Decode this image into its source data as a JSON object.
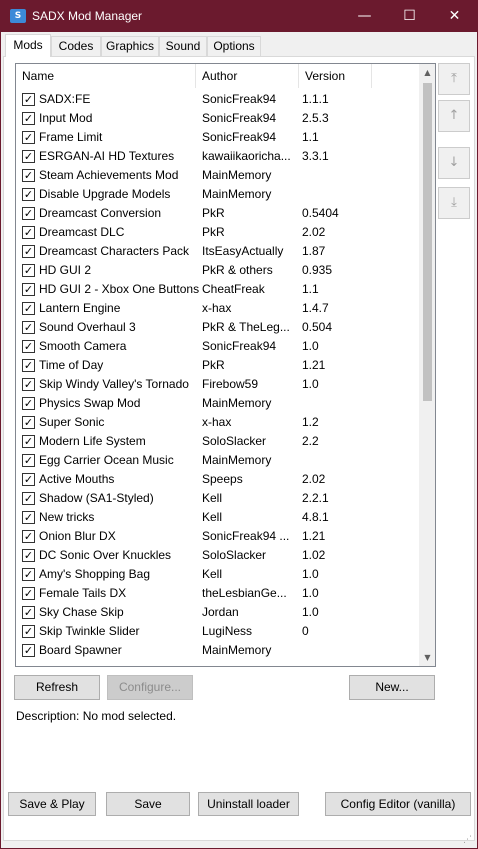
{
  "window": {
    "title": "SADX Mod Manager",
    "icon": "app-logo-icon"
  },
  "titlebar_controls": {
    "minimize": "—",
    "maximize": "☐",
    "close": "✕"
  },
  "tabs": [
    {
      "label": "Mods",
      "active": true
    },
    {
      "label": "Codes",
      "active": false
    },
    {
      "label": "Graphics",
      "active": false
    },
    {
      "label": "Sound",
      "active": false
    },
    {
      "label": "Options",
      "active": false
    }
  ],
  "mod_list": {
    "columns": [
      "Name",
      "Author",
      "Version"
    ],
    "rows": [
      {
        "name": "SADX:FE",
        "author": "SonicFreak94",
        "version": "1.1.1",
        "checked": true
      },
      {
        "name": "Input Mod",
        "author": "SonicFreak94",
        "version": "2.5.3",
        "checked": true
      },
      {
        "name": "Frame Limit",
        "author": "SonicFreak94",
        "version": "1.1",
        "checked": true
      },
      {
        "name": "ESRGAN-AI HD Textures",
        "author": "kawaiikaoricha...",
        "version": "3.3.1",
        "checked": true
      },
      {
        "name": "Steam Achievements Mod",
        "author": "MainMemory",
        "version": "",
        "checked": true
      },
      {
        "name": "Disable Upgrade Models",
        "author": "MainMemory",
        "version": "",
        "checked": true
      },
      {
        "name": "Dreamcast Conversion",
        "author": "PkR",
        "version": "0.5404",
        "checked": true
      },
      {
        "name": "Dreamcast DLC",
        "author": "PkR",
        "version": "2.02",
        "checked": true
      },
      {
        "name": "Dreamcast Characters Pack",
        "author": "ItsEasyActually",
        "version": "1.87",
        "checked": true
      },
      {
        "name": "HD GUI 2",
        "author": "PkR & others",
        "version": "0.935",
        "checked": true
      },
      {
        "name": "HD GUI 2 - Xbox One Buttons",
        "author": "CheatFreak",
        "version": "1.1",
        "checked": true
      },
      {
        "name": "Lantern Engine",
        "author": "x-hax",
        "version": "1.4.7",
        "checked": true
      },
      {
        "name": "Sound Overhaul 3",
        "author": "PkR & TheLeg...",
        "version": "0.504",
        "checked": true
      },
      {
        "name": "Smooth Camera",
        "author": "SonicFreak94",
        "version": "1.0",
        "checked": true
      },
      {
        "name": "Time of Day",
        "author": "PkR",
        "version": "1.21",
        "checked": true
      },
      {
        "name": "Skip Windy Valley's Tornado",
        "author": "Firebow59",
        "version": "1.0",
        "checked": true
      },
      {
        "name": "Physics Swap Mod",
        "author": "MainMemory",
        "version": "",
        "checked": true
      },
      {
        "name": "Super Sonic",
        "author": "x-hax",
        "version": "1.2",
        "checked": true
      },
      {
        "name": "Modern Life System",
        "author": "SoloSlacker",
        "version": "2.2",
        "checked": true
      },
      {
        "name": "Egg Carrier Ocean Music",
        "author": "MainMemory",
        "version": "",
        "checked": true
      },
      {
        "name": "Active Mouths",
        "author": "Speeps",
        "version": "2.02",
        "checked": true
      },
      {
        "name": "Shadow (SA1-Styled)",
        "author": "Kell",
        "version": "2.2.1",
        "checked": true
      },
      {
        "name": "New tricks",
        "author": "Kell",
        "version": "4.8.1",
        "checked": true
      },
      {
        "name": "Onion Blur DX",
        "author": "SonicFreak94 ...",
        "version": "1.21",
        "checked": true
      },
      {
        "name": "DC Sonic Over Knuckles",
        "author": "SoloSlacker",
        "version": "1.02",
        "checked": true
      },
      {
        "name": "Amy's Shopping Bag",
        "author": "Kell",
        "version": "1.0",
        "checked": true
      },
      {
        "name": "Female Tails DX",
        "author": "theLesbianGe...",
        "version": "1.0",
        "checked": true
      },
      {
        "name": "Sky Chase Skip",
        "author": "Jordan",
        "version": "1.0",
        "checked": true
      },
      {
        "name": "Skip Twinkle Slider",
        "author": "LugiNess",
        "version": "0",
        "checked": true
      },
      {
        "name": "Board Spawner",
        "author": "MainMemory",
        "version": "",
        "checked": true
      }
    ]
  },
  "side_buttons": [
    {
      "name": "move-top-button",
      "glyph": "⤒",
      "icon": "move-to-top-icon"
    },
    {
      "name": "move-up-button",
      "glyph": "↑",
      "icon": "move-up-icon"
    },
    {
      "name": "move-down-button",
      "glyph": "↓",
      "icon": "move-down-icon"
    },
    {
      "name": "move-bottom-button",
      "glyph": "⤓",
      "icon": "move-to-bottom-icon"
    }
  ],
  "actions": {
    "refresh": "Refresh",
    "configure": "Configure...",
    "new": "New..."
  },
  "description": "Description: No mod selected.",
  "footer": {
    "save_play": "Save & Play",
    "save": "Save",
    "uninstall": "Uninstall loader",
    "config_editor": "Config Editor (vanilla)"
  },
  "colors": {
    "titlebar": "#6b1a2e",
    "scroll_thumb": "#c1c1c1",
    "button_face": "#e1e1e1"
  }
}
